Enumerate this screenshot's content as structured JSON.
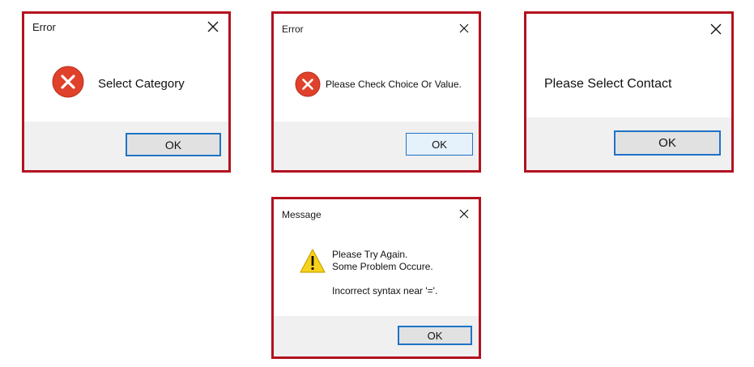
{
  "dialogs": [
    {
      "title": "Error",
      "message": "Select Category",
      "icon": "error-icon",
      "ok_label": "OK",
      "close_icon": "close-icon"
    },
    {
      "title": "Error",
      "message": "Please Check Choice Or Value.",
      "icon": "error-icon",
      "ok_label": "OK",
      "close_icon": "close-icon"
    },
    {
      "title": "",
      "message": "Please Select Contact",
      "ok_label": "OK",
      "close_icon": "close-icon"
    },
    {
      "title": "Message",
      "message_lines": [
        "Please Try Again.",
        "Some Problem Occure.",
        "Incorrect syntax near '='."
      ],
      "icon": "warning-icon",
      "ok_label": "OK",
      "close_icon": "close-icon"
    }
  ],
  "colors": {
    "frame": "#b3121f",
    "button_border": "#1e73c7",
    "error_red": "#e0412a",
    "warning_yellow": "#f7d21a"
  }
}
